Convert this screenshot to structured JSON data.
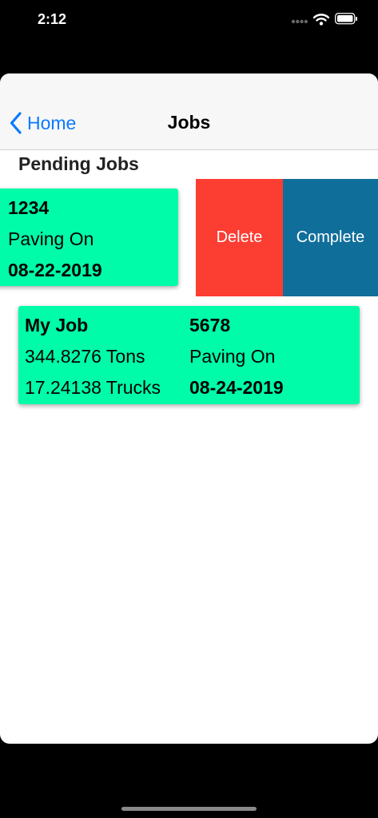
{
  "status_bar": {
    "time": "2:12"
  },
  "nav": {
    "back_label": "Home",
    "title": "Jobs"
  },
  "section": {
    "title": "Pending Jobs"
  },
  "jobs": [
    {
      "number": "1234",
      "status": "Paving On",
      "date": "08-22-2019"
    },
    {
      "name": "My Job",
      "number": "5678",
      "tons": "344.8276 Tons",
      "status": "Paving On",
      "trucks": "17.24138 Trucks",
      "date": "08-24-2019"
    }
  ],
  "actions": {
    "delete": "Delete",
    "complete": "Complete"
  },
  "colors": {
    "card": "#00fca8",
    "delete": "#fc3d32",
    "complete": "#106e9b",
    "link": "#0a7aff",
    "nav_background": "#f7f7f7"
  },
  "icons": [
    "signal-icon",
    "wifi-icon",
    "battery-icon",
    "chevron-left-icon"
  ]
}
